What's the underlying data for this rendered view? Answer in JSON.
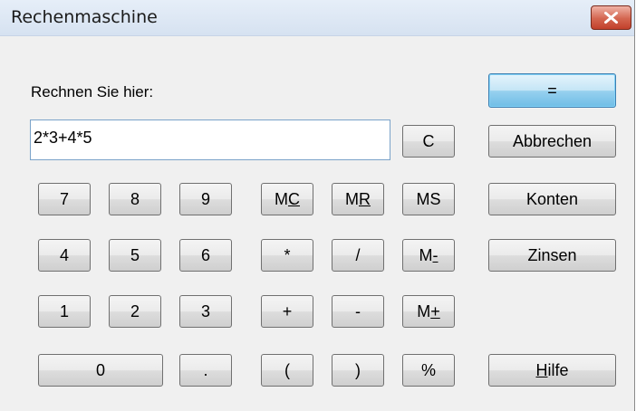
{
  "window": {
    "title": "Rechenmaschine"
  },
  "prompt_label": "Rechnen Sie hier:",
  "expression_input": {
    "value": "2*3+4*5"
  },
  "buttons": {
    "equals": "=",
    "clear": "C",
    "cancel": "Abbrechen",
    "accounts": "Konten",
    "interest": "Zinsen",
    "help_mnemonic": "H",
    "help_rest": "ilfe",
    "digits": [
      "7",
      "8",
      "9",
      "4",
      "5",
      "6",
      "1",
      "2",
      "3",
      "0"
    ],
    "decimal": ".",
    "multiply": "*",
    "divide": "/",
    "plus": "+",
    "minus": "-",
    "open_paren": "(",
    "close_paren": ")",
    "percent": "%",
    "mc_a": "M",
    "mc_b": "C",
    "mr_a": "M",
    "mr_b": "R",
    "ms": "MS",
    "mminus_a": "M",
    "mminus_b": "-",
    "mplus_a": "M",
    "mplus_b": "+"
  },
  "colors": {
    "close_button": "#c2402b",
    "input_border": "#7aa3c9",
    "default_button": "#98d1ef"
  }
}
